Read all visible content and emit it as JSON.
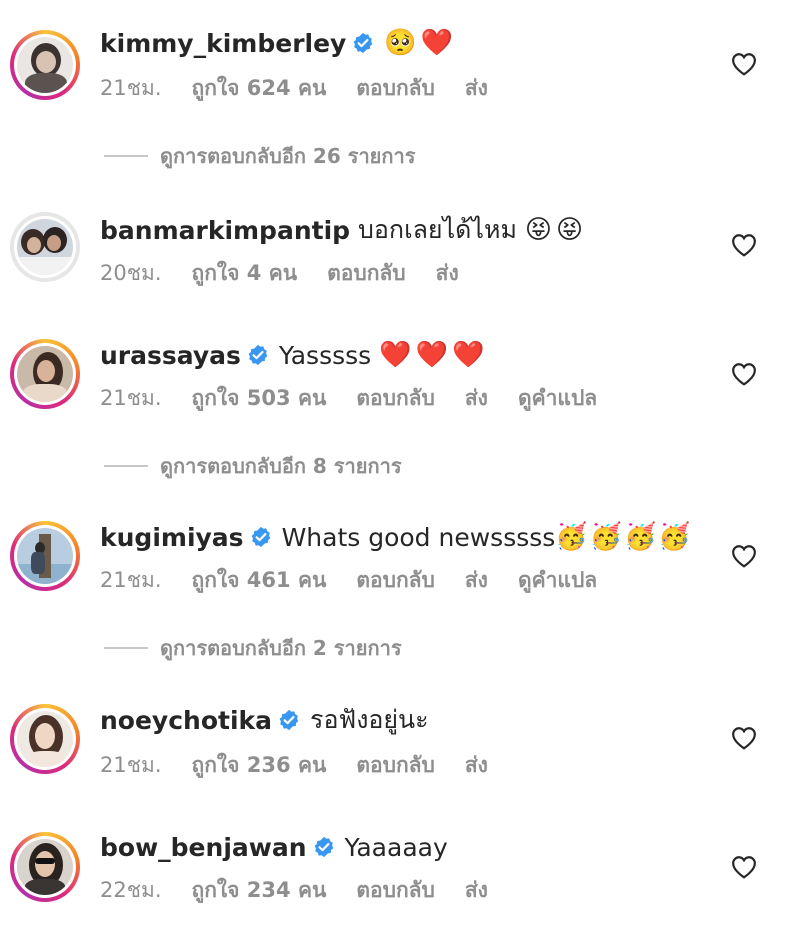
{
  "comments": [
    {
      "username": "kimmy_kimberley",
      "verified": true,
      "text": "",
      "emojis": [
        "🥺",
        "❤️"
      ],
      "time": "21ชม.",
      "likes": "ถูกใจ 624 คน",
      "reply": "ตอบกลับ",
      "send": "ส่ง",
      "view_replies": "ดูการตอบกลับอีก 26 รายการ"
    },
    {
      "username": "banmarkimpantip",
      "verified": false,
      "text": "บอกเลยได้ไหม",
      "emojis": [
        "😝",
        "😝"
      ],
      "time": "20ชม.",
      "likes": "ถูกใจ 4 คน",
      "reply": "ตอบกลับ",
      "send": "ส่ง"
    },
    {
      "username": "urassayas",
      "verified": true,
      "text": "Yasssss",
      "emojis": [
        "❤️",
        "❤️",
        "❤️"
      ],
      "time": "21ชม.",
      "likes": "ถูกใจ 503 คน",
      "reply": "ตอบกลับ",
      "send": "ส่ง",
      "translate": "ดูคำแปล",
      "view_replies": "ดูการตอบกลับอีก 8 รายการ"
    },
    {
      "username": "kugimiyas",
      "verified": true,
      "text": "Whats good newsssss",
      "emojis": [
        "🥳",
        "🥳",
        "🥳",
        "🥳"
      ],
      "time": "21ชม.",
      "likes": "ถูกใจ 461 คน",
      "reply": "ตอบกลับ",
      "send": "ส่ง",
      "translate": "ดูคำแปล",
      "view_replies": "ดูการตอบกลับอีก 2 รายการ"
    },
    {
      "username": "noeychotika",
      "verified": true,
      "text": "รอฟังอยู่นะ",
      "emojis": [],
      "time": "21ชม.",
      "likes": "ถูกใจ 236 คน",
      "reply": "ตอบกลับ",
      "send": "ส่ง"
    },
    {
      "username": "bow_benjawan",
      "verified": true,
      "text": "Yaaaaay",
      "emojis": [],
      "time": "22ชม.",
      "likes": "ถูกใจ 234 คน",
      "reply": "ตอบกลับ",
      "send": "ส่ง"
    }
  ],
  "colors": {
    "primary_text": "#262626",
    "secondary_text": "#8e8e8e",
    "verified_blue": "#3897f0",
    "divider": "#c7c7c7"
  },
  "icons": {
    "verified": "verified-badge-icon",
    "like": "heart-outline-icon"
  }
}
